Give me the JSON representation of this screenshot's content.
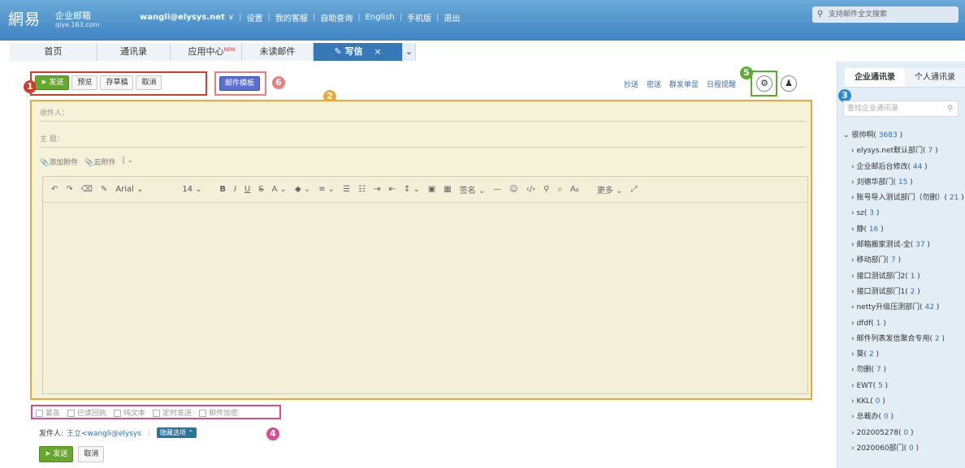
{
  "header": {
    "logo_main": "網易",
    "logo_sub": "企业邮箱",
    "logo_domain": "qiye.163.com",
    "user": "wangli@elysys.net",
    "user_caret": "∨",
    "nav": [
      "设置",
      "我的客服",
      "自助查询",
      "English",
      "手机版",
      "退出"
    ],
    "search_placeholder": "支持邮件全文搜索"
  },
  "tabs": [
    {
      "label": "首页"
    },
    {
      "label": "通讯录"
    },
    {
      "label": "应用中心",
      "badge": "NEW"
    },
    {
      "label": "未读邮件"
    },
    {
      "label": "写信",
      "active": true
    }
  ],
  "compose_bar": {
    "send": "发送",
    "preview": "预览",
    "draft": "存草稿",
    "cancel": "取消",
    "template": "邮件模板",
    "links": [
      "抄送",
      "密送",
      "群发单显",
      "日程提醒"
    ]
  },
  "compose": {
    "to_label": "收件人：",
    "subject_label": "主  题：",
    "attach": "添加附件",
    "cloud_attach": "云附件",
    "font": "Arial",
    "size": "14",
    "sign": "签名",
    "more": "更多"
  },
  "options": [
    "紧急",
    "已读回执",
    "纯文本",
    "定时发送",
    "邮件加密"
  ],
  "sender": {
    "label": "发件人:",
    "value": "王立<wangli@elysys",
    "hide": "隐藏选项"
  },
  "bottom": {
    "send": "发送",
    "cancel": "取消"
  },
  "sidebar": {
    "tabs": [
      "企业通讯录",
      "个人通讯录"
    ],
    "search_placeholder": "查找企业通讯录",
    "root": {
      "name": "很帅啊",
      "count": "3683"
    },
    "items": [
      {
        "name": "elysys.net默认部门",
        "count": "7"
      },
      {
        "name": "企业邮后台修改",
        "count": "44"
      },
      {
        "name": "刘德华部门",
        "count": "15"
      },
      {
        "name": "账号导入测试部门（勿删）",
        "count": "21"
      },
      {
        "name": "sz",
        "count": "3"
      },
      {
        "name": "静",
        "count": "16"
      },
      {
        "name": "邮箱搬家测试-全",
        "count": "37"
      },
      {
        "name": "移动部门",
        "count": "7"
      },
      {
        "name": "接口测试部门2",
        "count": "1"
      },
      {
        "name": "接口测试部门1",
        "count": "2"
      },
      {
        "name": "netty升级压测部门",
        "count": "42"
      },
      {
        "name": "dfdf",
        "count": "1"
      },
      {
        "name": "邮件列表发信聚合专用",
        "count": "2"
      },
      {
        "name": "葵",
        "count": "2"
      },
      {
        "name": "勿删",
        "count": "7"
      },
      {
        "name": "EWT",
        "count": "5"
      },
      {
        "name": "KKL",
        "count": "0"
      },
      {
        "name": "总裁办",
        "count": "0"
      },
      {
        "name": "202005278",
        "count": "0"
      },
      {
        "name": "2020060部门",
        "count": "0"
      }
    ]
  },
  "annotations": [
    "1",
    "2",
    "3",
    "4",
    "5",
    "6"
  ],
  "colors": {
    "annotation_red": "#d03b2e",
    "annotation_orange": "#e9a838",
    "annotation_blue": "#2b8ad6",
    "annotation_pink": "#d94c95",
    "annotation_green": "#5aad2e",
    "annotation_salmon": "#e8807c"
  }
}
